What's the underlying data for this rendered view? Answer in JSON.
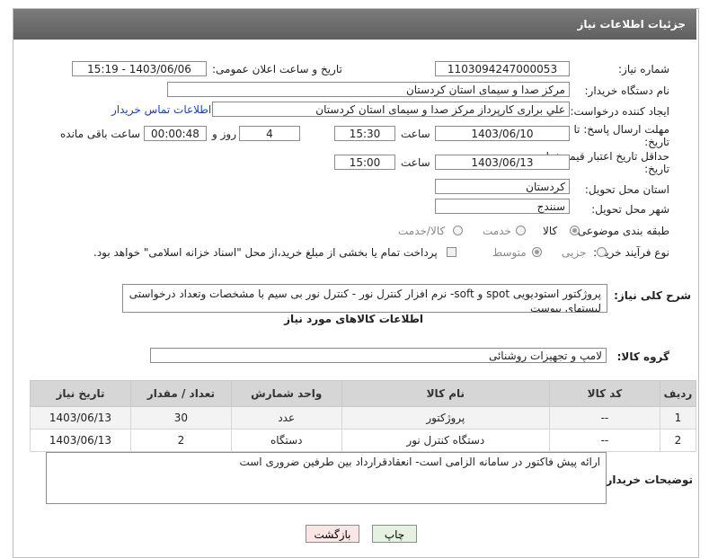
{
  "header": {
    "title": "جزئیات اطلاعات نیاز"
  },
  "fields": {
    "need_number_label": "شماره نیاز:",
    "need_number": "1103094247000053",
    "announce_label": "تاریخ و ساعت اعلان عمومی:",
    "announce_value": "1403/06/06 - 15:19",
    "buyer_label": "نام دستگاه خریدار:",
    "buyer_value": "مرکز صدا و سیمای استان کردستان",
    "creator_label": "ایجاد کننده درخواست:",
    "creator_value": "علي براری کارپرداز مرکز صدا و سیمای استان کردستان",
    "contact_link": "اطلاعات تماس خریدار",
    "deadline_label_1": "مهلت ارسال پاسخ: تا",
    "deadline_label_2": "تاریخ:",
    "deadline_date": "1403/06/10",
    "time_label": "ساعت",
    "deadline_time": "15:30",
    "days_value": "4",
    "days_label": "روز و",
    "remaining_time": "00:00:48",
    "remaining_label": "ساعت باقی مانده",
    "validity_label_1": "حداقل تاریخ اعتبار قیمت: تا",
    "validity_label_2": "تاریخ:",
    "validity_date": "1403/06/13",
    "validity_time": "15:00",
    "province_label": "استان محل تحویل:",
    "province_value": "کردستان",
    "city_label": "شهر محل تحویل:",
    "city_value": "سنندج",
    "category_label": "طبقه بندی موضوعی:",
    "category_options": [
      "کالا",
      "خدمت",
      "کالا/خدمت"
    ],
    "process_label": "نوع فرآیند خرید :",
    "process_options": [
      "جزیی",
      "متوسط"
    ],
    "payment_note": "پرداخت تمام یا بخشی از مبلغ خرید،از محل \"اسناد خزانه اسلامی\" خواهد بود."
  },
  "description": {
    "label": "شرح کلی نیاز:",
    "text": "پروژکتور استودیویی spot و soft- نرم افزار کنترل نور - کنترل نور بی سیم  با  مشخصات وتعداد درخواستی لیستهای پیوست"
  },
  "goods": {
    "section_title": "اطلاعات کالاهای مورد نیاز",
    "group_label": "گروه کالا:",
    "group_value": "لامپ و تجهیزات روشنائی",
    "columns": [
      "ردیف",
      "کد کالا",
      "نام کالا",
      "واحد شمارش",
      "تعداد / مقدار",
      "تاریخ نیاز"
    ],
    "rows": [
      [
        "1",
        "--",
        "پروژکتور",
        "عدد",
        "30",
        "1403/06/13"
      ],
      [
        "2",
        "--",
        "دستگاه کنترل نور",
        "دستگاه",
        "2",
        "1403/06/13"
      ]
    ]
  },
  "notes": {
    "label": "توضیحات خریدار:",
    "text": "ارائه پیش فاکتور در سامانه الزامی است- انعقادقرارداد بین طرفین ضروری  است"
  },
  "buttons": {
    "print": "چاپ",
    "back": "بازگشت"
  }
}
